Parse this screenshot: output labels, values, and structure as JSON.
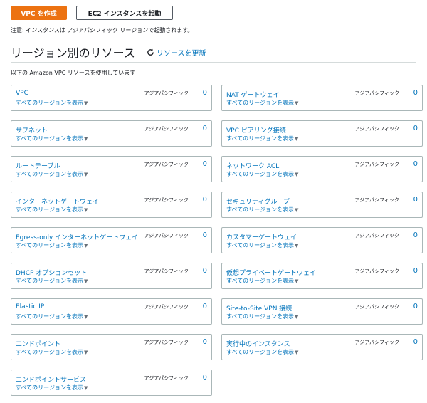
{
  "buttons": {
    "create_vpc": "VPC を作成",
    "launch_ec2": "EC2 インスタンスを起動"
  },
  "note": "注意: インスタンスは アジアパシフィック リージョンで起動されます。",
  "section": {
    "title": "リージョン別のリソース",
    "refresh": "リソースを更新"
  },
  "using_label": "以下の Amazon VPC リソースを使用しています",
  "region_label": "アジアパシフィック",
  "see_all_label": "すべてのリージョンを表示",
  "cards": [
    {
      "title": "VPC",
      "count": "0"
    },
    {
      "title": "NAT ゲートウェイ",
      "count": "0"
    },
    {
      "title": "サブネット",
      "count": "0"
    },
    {
      "title": "VPC ピアリング接続",
      "count": "0"
    },
    {
      "title": "ルートテーブル",
      "count": "0"
    },
    {
      "title": "ネットワーク ACL",
      "count": "0"
    },
    {
      "title": "インターネットゲートウェイ",
      "count": "0"
    },
    {
      "title": "セキュリティグループ",
      "count": "0"
    },
    {
      "title": "Egress-only インターネットゲートウェイ",
      "count": "0"
    },
    {
      "title": "カスタマーゲートウェイ",
      "count": "0"
    },
    {
      "title": "DHCP オプションセット",
      "count": "0"
    },
    {
      "title": "仮想プライベートゲートウェイ",
      "count": "0"
    },
    {
      "title": "Elastic IP",
      "count": "0"
    },
    {
      "title": "Site-to-Site VPN 接続",
      "count": "0"
    },
    {
      "title": "エンドポイント",
      "count": "0"
    },
    {
      "title": "実行中のインスタンス",
      "count": "0"
    },
    {
      "title": "エンドポイントサービス",
      "count": "0"
    }
  ],
  "colors": {
    "accent": "#ec7211",
    "link": "#0073bb",
    "border": "#aab7b8"
  },
  "icons": {
    "refresh": "refresh-icon",
    "dropdown": "caret-down-icon"
  }
}
